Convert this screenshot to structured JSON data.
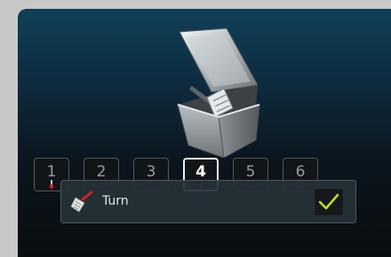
{
  "steps": [
    {
      "label": "1",
      "icon": "thermometer-icon",
      "active": false
    },
    {
      "label": "2",
      "icon": "dash-icon",
      "active": false
    },
    {
      "label": "3",
      "icon": "dash-icon",
      "active": false
    },
    {
      "label": "4",
      "icon": "dot-icon",
      "active": true
    },
    {
      "label": "5",
      "icon": "dash-icon",
      "active": false
    },
    {
      "label": "6",
      "icon": "grill-icon",
      "active": false
    }
  ],
  "action": {
    "label": "Turn",
    "icon": "spatula-icon"
  },
  "hero_icon": "container-with-spatula-icon",
  "colors": {
    "accent_check": "#c6df2a",
    "thermometer": "#d81e1e"
  }
}
